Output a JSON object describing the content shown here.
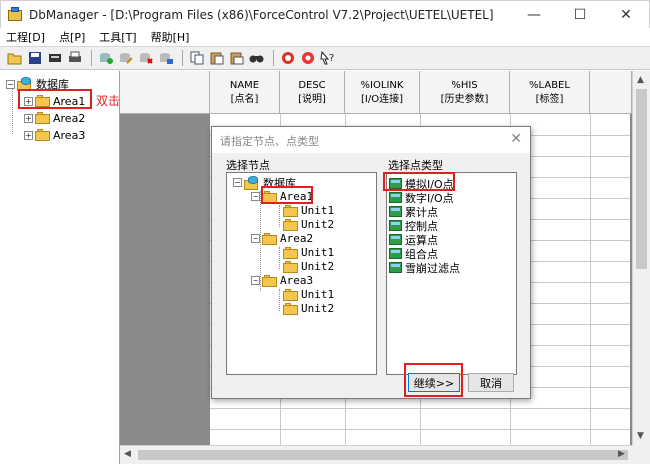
{
  "window": {
    "title": "DbManager - [D:\\Program Files (x86)\\ForceControl V7.2\\Project\\UETEL\\UETEL]",
    "minimize": "—",
    "maximize": "☐",
    "close": "✕"
  },
  "menu": [
    "工程[D]",
    "点[P]",
    "工具[T]",
    "帮助[H]"
  ],
  "toolbar_icons": [
    "open-icon",
    "save-icon",
    "cut-icon",
    "print-icon",
    "add-point-icon",
    "edit-point-icon",
    "delete-point-icon",
    "import-icon",
    "copy-icon",
    "paste-icon",
    "paste-special-icon",
    "find-icon",
    "stop-icon",
    "settings-icon",
    "help-icon"
  ],
  "tree": {
    "root": "数据库",
    "items": [
      "Area1",
      "Area2",
      "Area3"
    ]
  },
  "annotation": {
    "double_click": "双击"
  },
  "grid": {
    "columns": [
      {
        "name": "NAME",
        "sub": "[点名]"
      },
      {
        "name": "DESC",
        "sub": "[说明]"
      },
      {
        "name": "%IOLINK",
        "sub": "[I/O连接]"
      },
      {
        "name": "%HIS",
        "sub": "[历史参数]"
      },
      {
        "name": "%LABEL",
        "sub": "[标签]"
      }
    ]
  },
  "dialog": {
    "title": "请指定节点、点类型",
    "close": "✕",
    "node_label": "选择节点",
    "type_label": "选择点类型",
    "node_tree": {
      "root": "数据库",
      "areas": [
        {
          "name": "Area1",
          "units": [
            "Unit1",
            "Unit2"
          ]
        },
        {
          "name": "Area2",
          "units": [
            "Unit1",
            "Unit2"
          ]
        },
        {
          "name": "Area3",
          "units": [
            "Unit1",
            "Unit2"
          ]
        }
      ]
    },
    "point_types": [
      "模拟I/O点",
      "数字I/O点",
      "累计点",
      "控制点",
      "运算点",
      "组合点",
      "雪崩过滤点"
    ],
    "continue_button": "继续>>",
    "cancel_button": "取消"
  },
  "colors": {
    "highlight": "#e02020",
    "grid_background": "#8a8a8a",
    "folder": "#f3c74f"
  }
}
